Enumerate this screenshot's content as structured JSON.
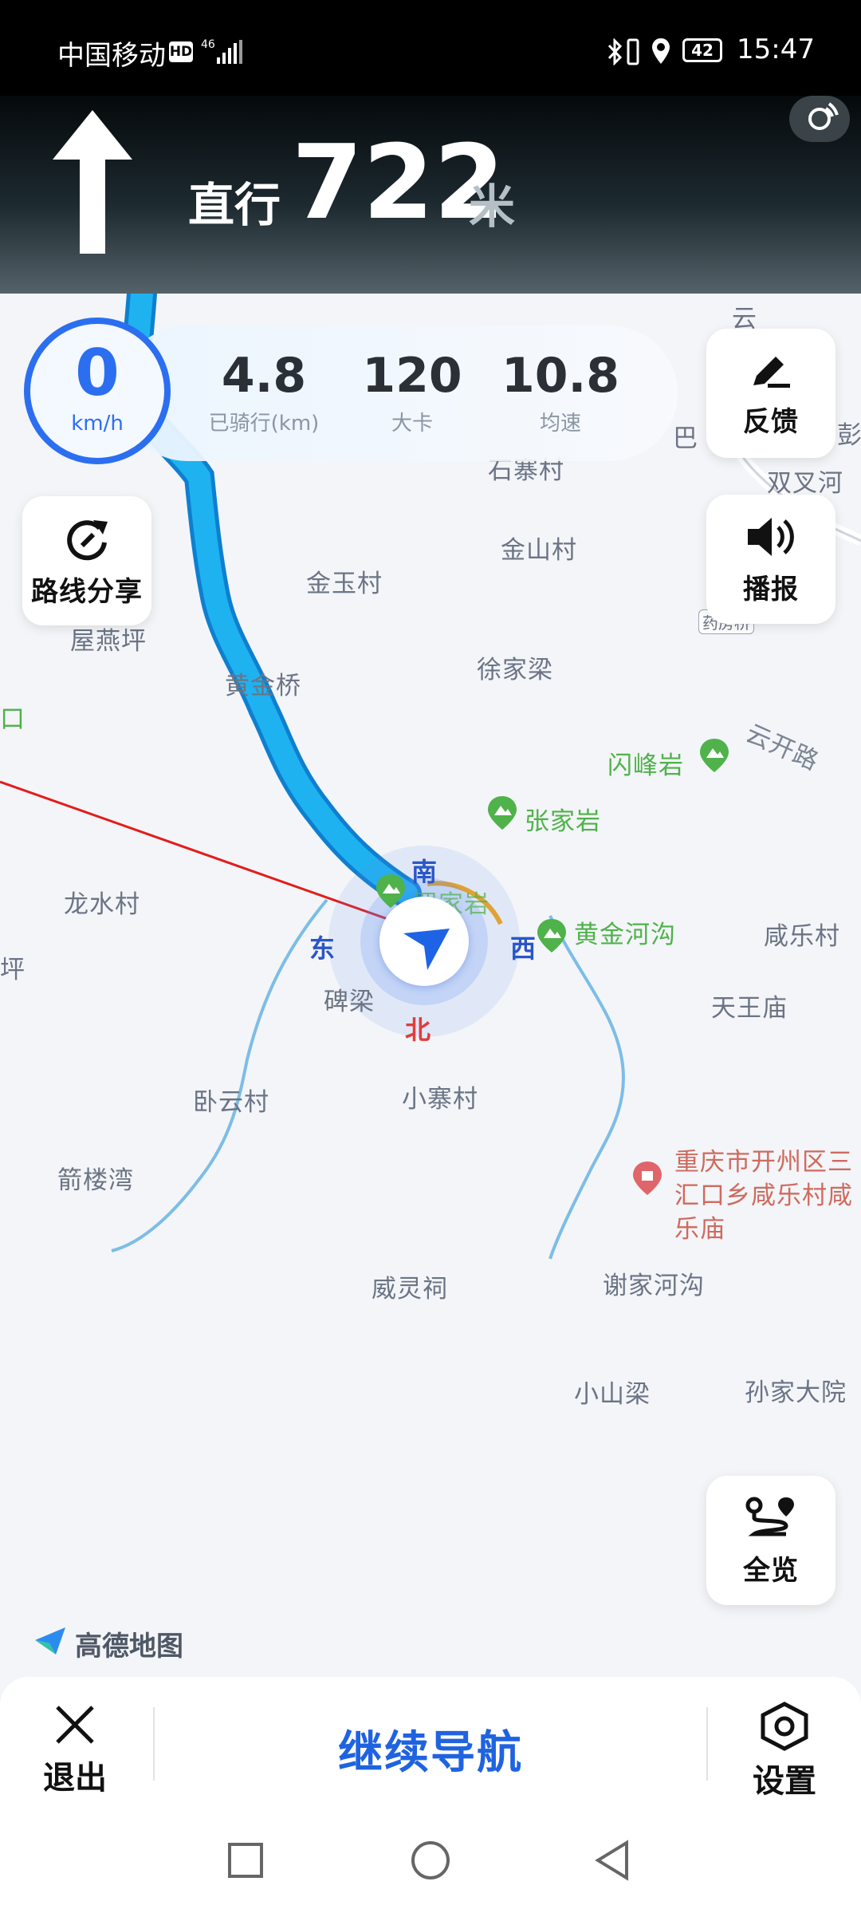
{
  "status_bar": {
    "carrier": "中国移动",
    "hd": "HD",
    "net": "46",
    "battery": "42",
    "time": "15:47"
  },
  "nav": {
    "instruction": "直行",
    "distance": "722",
    "unit": "米"
  },
  "stats": {
    "speed": "0",
    "speed_unit": "km/h",
    "distance_value": "4.8",
    "distance_label": "已骑行(km)",
    "calorie_value": "120",
    "calorie_label": "大卡",
    "avg_value": "10.8",
    "avg_label": "均速"
  },
  "buttons": {
    "feedback": "反馈",
    "broadcast": "播报",
    "share_route": "路线分享",
    "overview": "全览"
  },
  "compass": {
    "south": "南",
    "east": "东",
    "west": "西",
    "north": "北"
  },
  "map_labels": {
    "yun": "云",
    "ba": "巴",
    "peng": "彭",
    "shizhai": "石寨村",
    "shuangcha": "双叉河",
    "jinshan": "金山村",
    "jinyu": "金玉村",
    "yaofang": "药房桥",
    "wuyan": "屋燕坪",
    "xujia": "徐家梁",
    "huangjinqiao": "黄金桥",
    "kou": "口",
    "yunkai": "云开路",
    "longshui": "龙水村",
    "xianle": "咸乐村",
    "ping": "坪",
    "beiliang": "碑梁",
    "tianwang": "天王庙",
    "woyun": "卧云村",
    "xiaozhai": "小寨村",
    "jianlou": "箭楼湾",
    "weiling": "威灵祠",
    "xiejia": "谢家河沟",
    "xiaoshan": "小山梁",
    "sunjia": "孙家大院",
    "temple_poi": "重庆市开州区三汇口乡咸乐村咸乐庙"
  },
  "pois": {
    "shanfeng": "闪峰岩",
    "zhangjia": "张家岩",
    "luojia": "罗家岩",
    "huangjinhe": "黄金河沟"
  },
  "brand": "高德地图",
  "bottom": {
    "exit": "退出",
    "continue": "继续导航",
    "settings": "设置"
  },
  "colors": {
    "route": "#19a8ea",
    "accent": "#2b6ff0",
    "continue": "#1f63e0",
    "poi_green": "#4fb24a",
    "north_red": "#e23b3b"
  }
}
